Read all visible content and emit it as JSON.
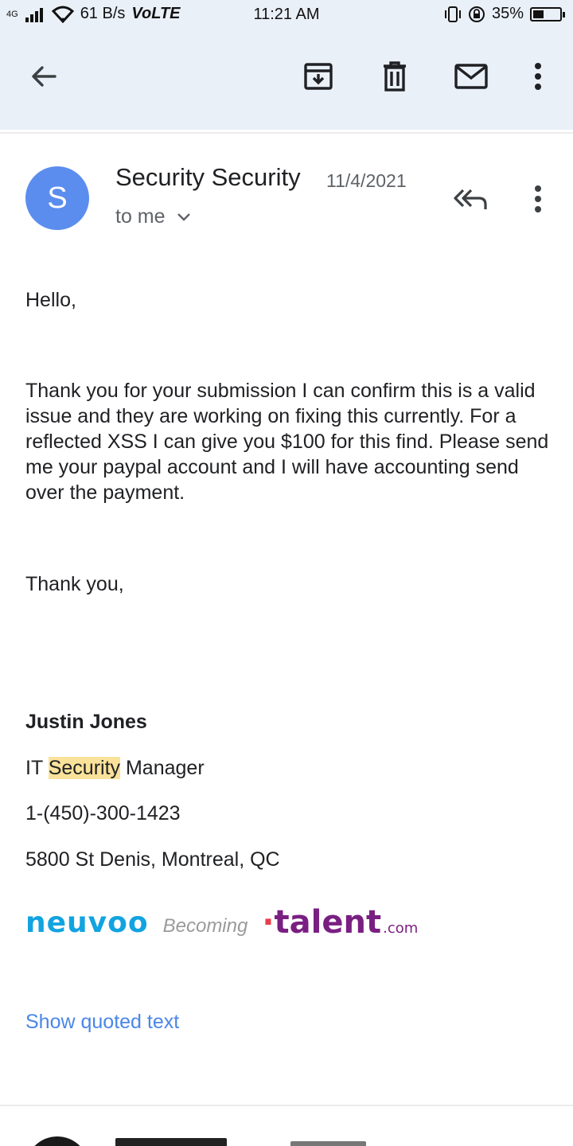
{
  "status_bar": {
    "network": "4G",
    "speed": "61 B/s",
    "volte": "VoLTE",
    "time": "11:21 AM",
    "battery": "35%",
    "battery_level": 0.35
  },
  "toolbar": {
    "back_icon": "arrow-left-icon",
    "archive_icon": "archive-icon",
    "delete_icon": "trash-icon",
    "mark_unread_icon": "mail-icon",
    "more_icon": "more-vertical-icon"
  },
  "message": {
    "avatar_letter": "S",
    "avatar_color": "#5b8dee",
    "sender": "Security Security",
    "date": "11/4/2021",
    "recipient": "to me",
    "greeting": "Hello,",
    "body": "Thank you for your submission I can confirm this is a valid issue and they are working on fixing this currently. For a reflected XSS I can give you $100 for this find. Please send me your paypal account and I will have accounting send over the payment.",
    "closing": "Thank you,",
    "signature": {
      "name": "Justin Jones",
      "title_prefix": "IT ",
      "title_highlight": "Security",
      "title_suffix": " Manager",
      "phone": "1-(450)-300-1423",
      "address": "5800 St Denis, Montreal, QC"
    },
    "logos": {
      "neuvoo": "neuvoo",
      "becoming": "Becoming",
      "talent_dot": "·",
      "talent": "talent",
      "talent_suffix": ".com"
    },
    "show_quoted": "Show quoted text"
  }
}
